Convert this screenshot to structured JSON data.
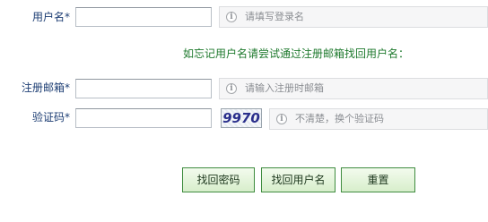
{
  "form": {
    "username": {
      "label": "用户名",
      "required_mark": "*",
      "value": "",
      "hint": "请填写登录名"
    },
    "notice": "如忘记用户名请尝试通过注册邮箱找回用户名：",
    "email": {
      "label": "注册邮箱",
      "required_mark": "*",
      "value": "",
      "hint": "请输入注册时邮箱"
    },
    "captcha": {
      "label": "验证码",
      "required_mark": "*",
      "value": "",
      "image_text": "9970",
      "hint": "不清楚，换个验证码"
    },
    "buttons": {
      "find_password": "找回密码",
      "find_username": "找回用户名",
      "reset": "重置"
    }
  },
  "colors": {
    "label_text": "#1c3d73",
    "notice_text": "#1f7a2e",
    "button_border": "#3f8c3f",
    "hint_background": "#f6f6f7"
  },
  "icons": {
    "hint_icon": "info-icon"
  }
}
